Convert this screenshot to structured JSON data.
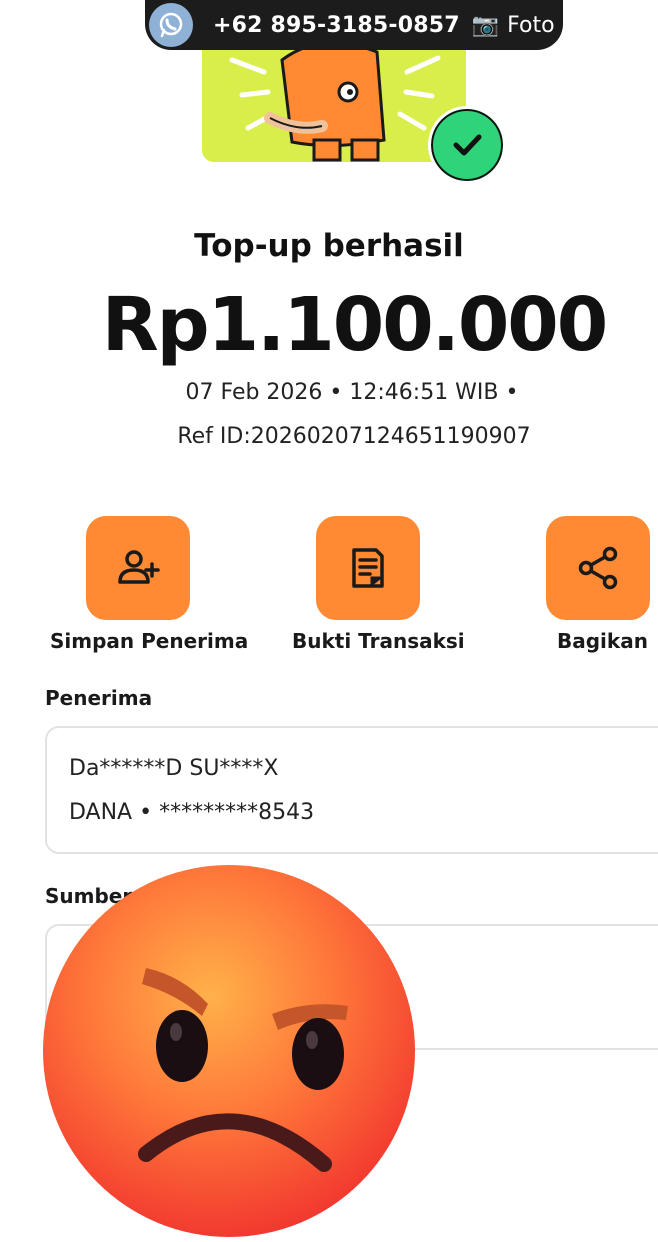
{
  "overlay": {
    "phone": "+62 895-3185-0857",
    "camera_glyph": "📷",
    "foto_label": "Foto",
    "icon": "whatsapp-icon"
  },
  "status": {
    "title": "Top-up berhasil",
    "amount": "Rp1.100.000",
    "datetime": "07 Feb 2026 • 12:46:51 WIB •",
    "ref_id": "Ref ID:20260207124651190907"
  },
  "actions": [
    {
      "label": "Simpan Penerima",
      "icon": "add-user-icon"
    },
    {
      "label": "Bukti Transaksi",
      "icon": "receipt-icon"
    },
    {
      "label": "Bagikan",
      "icon": "share-icon"
    }
  ],
  "recipient": {
    "section_label": "Penerima",
    "name": "Da******D SU****X",
    "account": "DANA • *********8543"
  },
  "source": {
    "section_label": "Sumber d"
  },
  "colors": {
    "accent": "#ff8a33",
    "hero_bg": "#d9ee4a",
    "success": "#2ed37a"
  }
}
